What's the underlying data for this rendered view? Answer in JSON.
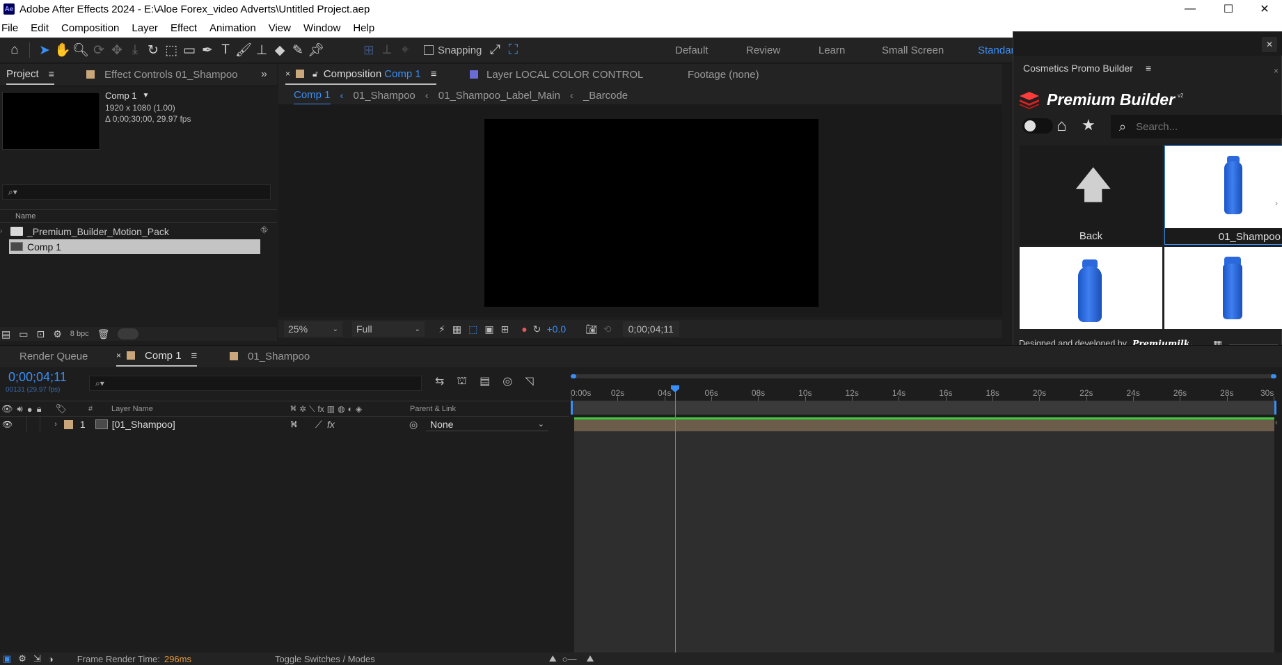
{
  "window": {
    "title": "Adobe After Effects 2024 - E:\\Aloe Forex_video Adverts\\Untitled Project.aep",
    "app_icon": "Ae"
  },
  "menu": [
    "File",
    "Edit",
    "Composition",
    "Layer",
    "Effect",
    "Animation",
    "View",
    "Window",
    "Help"
  ],
  "toolbar": {
    "snapping_label": "Snapping",
    "workspaces": [
      "Default",
      "Review",
      "Learn",
      "Small Screen",
      "Standard"
    ],
    "active_workspace": "Standard"
  },
  "project_panel": {
    "tab": "Project",
    "effect_controls_tab": "Effect Controls 01_Shampoo",
    "comp_name": "Comp 1",
    "comp_size": "1920 x 1080 (1.00)",
    "comp_duration": "Δ 0;00;30;00, 29.97 fps",
    "column_name": "Name",
    "items": [
      "_Premium_Builder_Motion_Pack",
      "Comp 1"
    ],
    "bpc": "8 bpc"
  },
  "comp_panel": {
    "tab_prefix": "Composition",
    "tab_comp": "Comp 1",
    "layer_tab": "Layer  LOCAL COLOR CONTROL",
    "footage_tab": "Footage (none)",
    "breadcrumb": [
      "Comp 1",
      "01_Shampoo",
      "01_Shampoo_Label_Main",
      "_Barcode"
    ],
    "zoom": "25%",
    "resolution": "Full",
    "exposure": "+0.0",
    "timecode": "0;00;04;11"
  },
  "plugin": {
    "panel_title": "Cosmetics Promo Builder",
    "brand": "Premium Builder",
    "version": "v2",
    "search_placeholder": "Search...",
    "tiles": [
      {
        "label": "Back"
      },
      {
        "label": "01_Shampoo"
      }
    ],
    "footer": "Designed and developed by",
    "footer_brand": "Premiumilk."
  },
  "timeline": {
    "render_queue_tab": "Render Queue",
    "comp_tab": "Comp 1",
    "shampoo_tab": "01_Shampoo",
    "timecode": "0;00;04;11",
    "frame_info": "00131 (29.97 fps)",
    "col_hash": "#",
    "col_layer_name": "Layer Name",
    "col_parent": "Parent & Link",
    "layer": {
      "index": "1",
      "name": "[01_Shampoo]",
      "parent": "None"
    },
    "ruler": [
      "0:00s",
      "02s",
      "04s",
      "06s",
      "08s",
      "10s",
      "12s",
      "14s",
      "16s",
      "18s",
      "20s",
      "22s",
      "24s",
      "26s",
      "28s",
      "30s"
    ]
  },
  "status": {
    "frame_render_label": "Frame Render Time:",
    "frame_render_value": "296ms",
    "toggle": "Toggle Switches / Modes"
  },
  "colors": {
    "accent": "#3a8ef6",
    "label_tan": "#c9a77a",
    "layer_bar": "#6b5d4a",
    "green": "#3ccc3c",
    "orange": "#e89a3c"
  }
}
